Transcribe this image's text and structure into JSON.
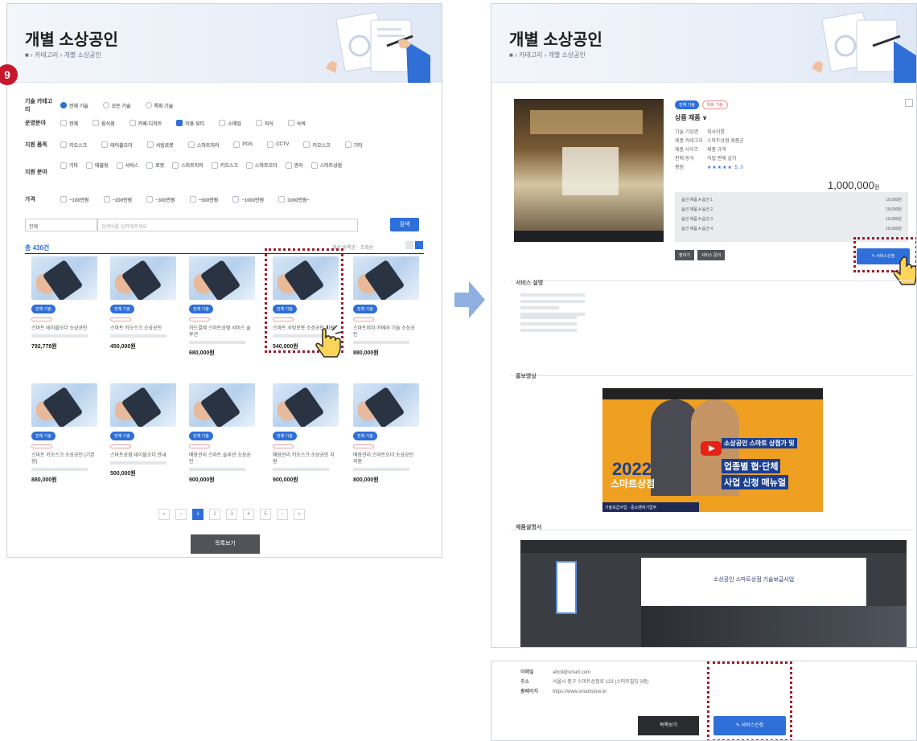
{
  "step_badge": "9",
  "left": {
    "title": "개별 소상공인",
    "breadcrumb": "■ › 카테고리 › 개별 소상공인",
    "filters": [
      {
        "label": "기술 카테고리",
        "opts": [
          "전체 기술",
          "모든 기술",
          "특화 기술"
        ],
        "on": 0
      },
      {
        "label": "운영분야",
        "opts": [
          "전체",
          "음식점",
          "카페·디저트",
          "미용·뷰티",
          "소매업",
          "외식",
          "숙박"
        ],
        "on": 3
      },
      {
        "label": "지원 품목",
        "opts": [
          "키오스크",
          "테이블오더",
          "서빙로봇",
          "스마트미러",
          "POS",
          "CCTV",
          "키오스크",
          "기타"
        ],
        "on": -1
      },
      {
        "label": "지원 분야",
        "opts": [
          "기타",
          "태블릿",
          "서비스",
          "로봇",
          "스마트미러",
          "키오스크",
          "스마트오더",
          "관리",
          "스마트상점"
        ],
        "on": -1
      },
      {
        "label": "가격",
        "opts": [
          "~100만원",
          "~200만원",
          "~300만원",
          "~500만원",
          "~1000만원",
          "1000만원~"
        ],
        "on": -1
      }
    ],
    "select_label": "전체",
    "search_placeholder": "검색어를 입력해주세요",
    "search_button": "검색",
    "result_count": "총 430건",
    "sort_label": "최신 등록순 · 조회순",
    "products": [
      {
        "tag": "전체 기술",
        "title": "스마트 테이블오더 소상공인",
        "price": "792,778원"
      },
      {
        "tag": "전체 기술",
        "title": "스마트 키오스크 소상공인",
        "price": "450,000원"
      },
      {
        "tag": "전체 기술",
        "title": "카드결제 스마트상점 서비스 솔루션",
        "price": "680,000원"
      },
      {
        "tag": "전체 기술",
        "title": "스마트 서빙로봇 소상공인 지원",
        "price": "540,000원"
      },
      {
        "tag": "전체 기술",
        "title": "스마트미러 카메라 기술 소상공인",
        "price": "880,000원"
      },
      {
        "tag": "전체 기술",
        "title": "스마트 키오스크 소상공인 (기본형)",
        "price": "880,000원"
      },
      {
        "tag": "전체 기술",
        "title": "스마트상점 테이블오더 안내",
        "price": "500,000원"
      },
      {
        "tag": "전체 기술",
        "title": "매장관리 스마트 솔루션 소상공인",
        "price": "900,000원"
      },
      {
        "tag": "전체 기술",
        "title": "매장관리 키오스크 소상공인 지원",
        "price": "900,000원"
      },
      {
        "tag": "전체 기술",
        "title": "매장관리 스마트오더 소상공인 지원",
        "price": "800,000원"
      }
    ],
    "pages": [
      "«",
      "‹",
      "1",
      "2",
      "3",
      "4",
      "5",
      "›",
      "»"
    ],
    "more_button": "목록보기"
  },
  "right": {
    "title": "개별 소상공인",
    "breadcrumb": "■ › 카테고리 › 개별 소상공인",
    "badges": [
      "전체 기술",
      "특화 기술"
    ],
    "product_name": "상품 제품 ∨",
    "specs": [
      {
        "k": "기술 기업명",
        "v": "회사이름"
      },
      {
        "k": "제품 카테고리",
        "v": "스마트상점 제품군"
      },
      {
        "k": "제품 사이즈",
        "v": "제품 규격"
      },
      {
        "k": "판매 방식",
        "v": "직접 판매 설치"
      },
      {
        "k": "평점",
        "v": "★★★★★ 5.0"
      }
    ],
    "price": "1,000,000",
    "price_unit": "원",
    "options": [
      {
        "name": "옵션 제품 A 옵션 1",
        "val": "10,000원"
      },
      {
        "name": "옵션 제품 A 옵션 2",
        "val": "10,000원"
      },
      {
        "name": "옵션 제품 A 옵션 3",
        "val": "10,000원"
      },
      {
        "name": "옵션 제품 A 옵션 4",
        "val": "10,000원"
      }
    ],
    "btn_a": "찜하기",
    "btn_b": "서비스 문의",
    "apply_button": "✎ 서비스신청",
    "sections": [
      "서비스 설명",
      "홍보영상",
      "제품설명서"
    ],
    "video": {
      "year": "2022",
      "line1": "스마트상점",
      "line2": "소상공인 스마트 상점가 및",
      "line3": "업종별 협·단체",
      "line4": "사업 신청 매뉴얼",
      "footer": "기술보급사업 · 중소벤처기업부"
    },
    "ppt_title": "소상공인 스마트상점 기술보급사업"
  },
  "bottom": {
    "rows": [
      {
        "k": "이메일",
        "v": "abcd@smart.com"
      },
      {
        "k": "주소",
        "v": "서울시 중구 스마트상점로 123 (스마트빌딩 3층)"
      },
      {
        "k": "홈페이지",
        "v": "https://www.smartstore.kr"
      }
    ],
    "list_button": "목록보기",
    "apply_button": "✎ 서비스신청"
  }
}
